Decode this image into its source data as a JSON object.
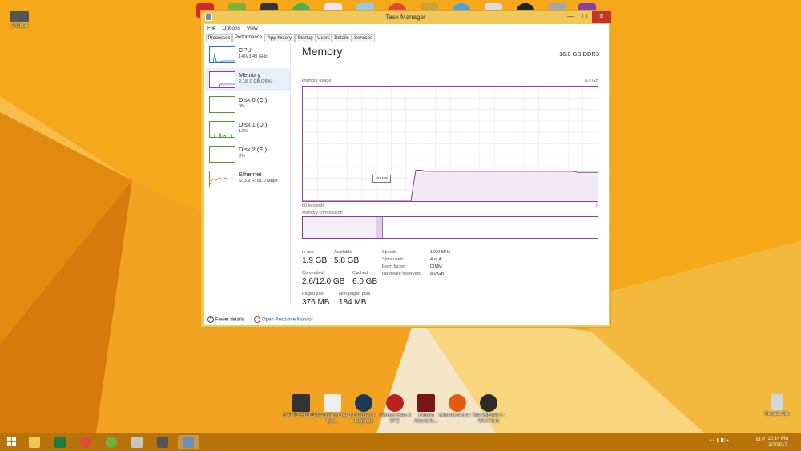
{
  "desktop": {
    "top_left_icon": "Untitled",
    "recycle_bin": "Recycle Bin",
    "icons": [
      {
        "label": "BATTLEFIELD 4"
      },
      {
        "label": "Assassin's Creed Syn..."
      },
      {
        "label": "League of Legends"
      },
      {
        "label": "Serious Sam 3 BFE"
      },
      {
        "label": "Hitman Absolutio..."
      },
      {
        "label": "Mortal Kombat ..."
      },
      {
        "label": "The Witcher 3 - Wild Hunt"
      }
    ]
  },
  "window": {
    "title": "Task Manager",
    "min_label": "—",
    "max_label": "☐",
    "close_label": "✕"
  },
  "menu": [
    "File",
    "Options",
    "View"
  ],
  "tabs": [
    "Processes",
    "Performance",
    "App history",
    "Startup",
    "Users",
    "Details",
    "Services"
  ],
  "resources": [
    {
      "name": "CPU",
      "sub": "14% 3.49 GHz",
      "color": "#1f7ab8"
    },
    {
      "name": "Memory",
      "sub": "2.1/8.0 GB (26%)",
      "color": "#8c3e9c"
    },
    {
      "name": "Disk 0 (C:)",
      "sub": "0%",
      "color": "#4f9a2b"
    },
    {
      "name": "Disk 1 (D:)",
      "sub": "12%",
      "color": "#4f9a2b"
    },
    {
      "name": "Disk 2 (E:)",
      "sub": "0%",
      "color": "#4f9a2b"
    },
    {
      "name": "Ethernet",
      "sub": "S: 3.9  R: 81.0 Mbps",
      "color": "#c26b1d"
    }
  ],
  "memory": {
    "title": "Memory",
    "capacity": "16.0 GB DDR3",
    "usage_label": "Memory usage",
    "usage_max": "8.0 GB",
    "time_label": "60 seconds",
    "time_end": "0",
    "tooltip": "In use",
    "composition_label": "Memory composition",
    "in_use_label": "In use",
    "in_use": "1.9 GB",
    "available_label": "Available",
    "available": "5.8 GB",
    "committed_label": "Committed",
    "committed": "2.6/12.0 GB",
    "cached_label": "Cached",
    "cached": "6.0 GB",
    "paged_label": "Paged pool",
    "paged": "376 MB",
    "nonpaged_label": "Non-paged pool",
    "nonpaged": "184 MB",
    "speed_label": "Speed:",
    "speed": "1600 MHz",
    "slots_label": "Slots used:",
    "slots": "4 of 4",
    "form_label": "Form factor:",
    "form": "DIMM",
    "hwres_label": "Hardware reserved:",
    "hwres": "8.0 GB",
    "history": [
      0,
      0,
      0,
      0,
      0,
      0,
      0,
      0,
      0,
      0,
      0,
      0,
      0,
      0,
      0,
      0,
      0,
      0,
      0,
      0,
      0,
      0,
      0,
      0.27,
      0.27,
      0.26,
      0.26,
      0.26,
      0.26,
      0.26,
      0.26,
      0.26,
      0.26,
      0.26,
      0.26,
      0.26,
      0.26,
      0.26,
      0.26,
      0.26,
      0.26,
      0.26,
      0.26,
      0.26,
      0.26,
      0.26,
      0.26,
      0.26,
      0.26,
      0.26,
      0.26,
      0.26,
      0.26,
      0.26,
      0.26,
      0.26,
      0.25,
      0.25,
      0.25,
      0.25,
      0.25
    ]
  },
  "footer": {
    "fewer": "Fewer details",
    "resmon": "Open Resource Monitor"
  },
  "taskbar": {
    "lang": "БГР",
    "time": "10:14 PM",
    "date": "2/7/2017"
  }
}
